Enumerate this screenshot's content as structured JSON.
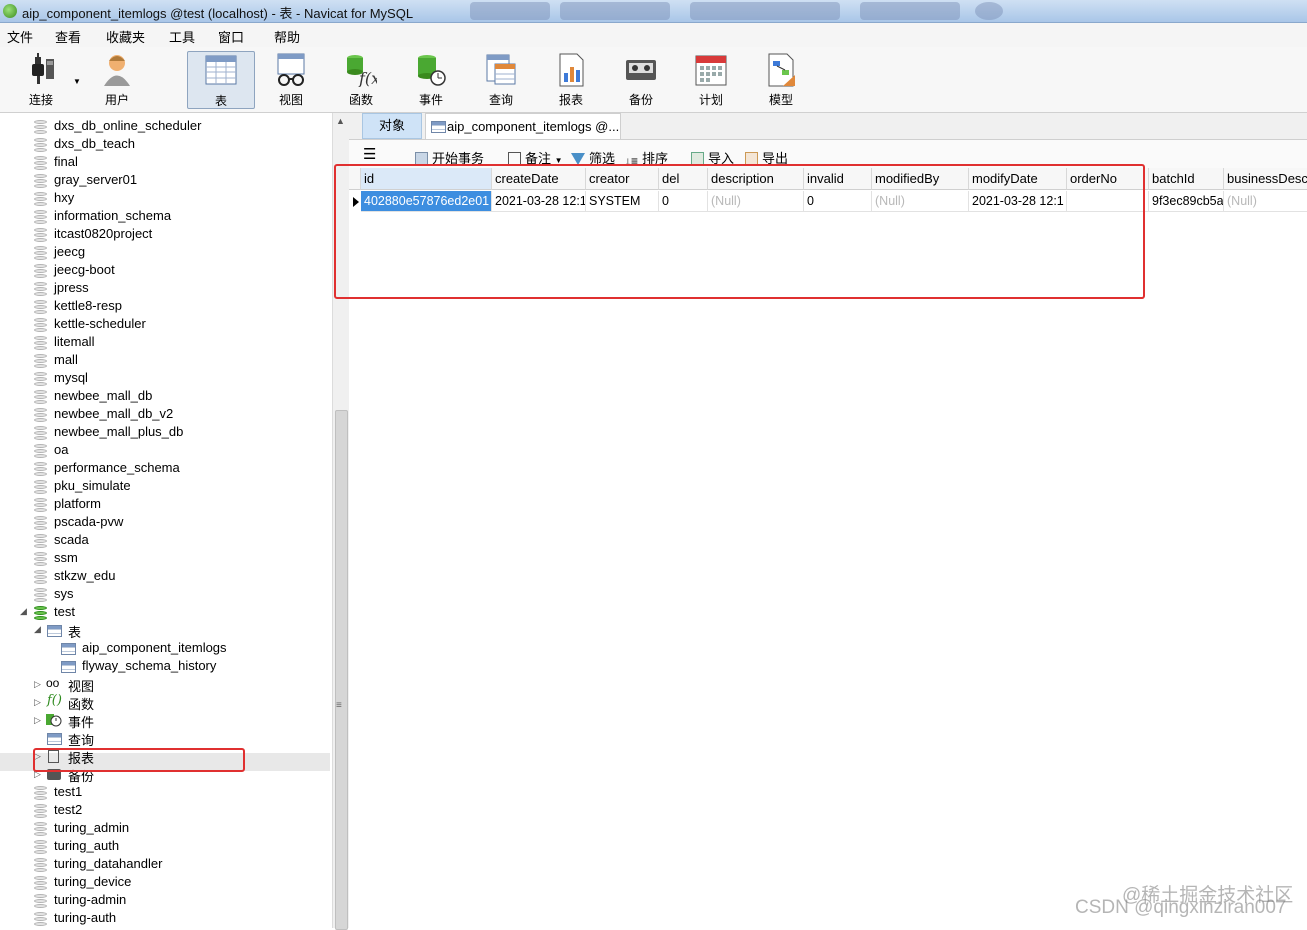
{
  "window": {
    "title": "aip_component_itemlogs @test (localhost) - 表 - Navicat for MySQL"
  },
  "menu": [
    "文件",
    "查看",
    "收藏夹",
    "工具",
    "窗口",
    "帮助"
  ],
  "toolbar": [
    {
      "label": "连接",
      "icon": "plug-icon"
    },
    {
      "label": "用户",
      "icon": "user-icon"
    },
    {
      "label": "表",
      "icon": "table-icon",
      "active": true
    },
    {
      "label": "视图",
      "icon": "glasses-icon"
    },
    {
      "label": "函数",
      "icon": "function-icon"
    },
    {
      "label": "事件",
      "icon": "event-icon"
    },
    {
      "label": "查询",
      "icon": "query-icon"
    },
    {
      "label": "报表",
      "icon": "report-icon"
    },
    {
      "label": "备份",
      "icon": "backup-icon"
    },
    {
      "label": "计划",
      "icon": "calendar-icon"
    },
    {
      "label": "模型",
      "icon": "model-icon"
    }
  ],
  "sidebar": {
    "databases_top": [
      "dxs_db_online_scheduler",
      "dxs_db_teach",
      "final",
      "gray_server01",
      "hxy",
      "information_schema",
      "itcast0820project",
      "jeecg",
      "jeecg-boot",
      "jpress",
      "kettle8-resp",
      "kettle-scheduler",
      "litemall",
      "mall",
      "mysql",
      "newbee_mall_db",
      "newbee_mall_db_v2",
      "newbee_mall_plus_db",
      "oa",
      "performance_schema",
      "pku_simulate",
      "platform",
      "pscada-pvw",
      "scada",
      "ssm",
      "stkzw_edu",
      "sys"
    ],
    "open_db": "test",
    "tables_folder": "表",
    "tables": [
      "aip_component_itemlogs",
      "flyway_schema_history"
    ],
    "categories": [
      "视图",
      "函数",
      "事件",
      "查询",
      "报表",
      "备份"
    ],
    "databases_bottom": [
      "test1",
      "test2",
      "turing_admin",
      "turing_auth",
      "turing_datahandler",
      "turing_device",
      "turing-admin",
      "turing-auth"
    ]
  },
  "tabs": {
    "objects": "对象",
    "table": "aip_component_itemlogs @..."
  },
  "subtoolbar": {
    "begin_tx": "开始事务",
    "notes": "备注",
    "filter": "筛选",
    "sort": "排序",
    "import": "导入",
    "export": "导出"
  },
  "grid": {
    "columns": [
      "id",
      "createDate",
      "creator",
      "del",
      "description",
      "invalid",
      "modifiedBy",
      "modifyDate",
      "orderNo",
      "batchId",
      "businessDesc"
    ],
    "rows": [
      [
        "402880e57876ed2e01",
        "2021-03-28 12:1",
        "SYSTEM",
        "0",
        "(Null)",
        "0",
        "(Null)",
        "2021-03-28 12:1",
        "",
        "9f3ec89cb5a",
        "(Null)"
      ]
    ]
  },
  "watermark": {
    "line1": "@稀土掘金技术社区",
    "line2": "CSDN @qingxinziran007"
  },
  "colors": {
    "accent_red": "#e03030",
    "selection": "#3d8ee0"
  }
}
